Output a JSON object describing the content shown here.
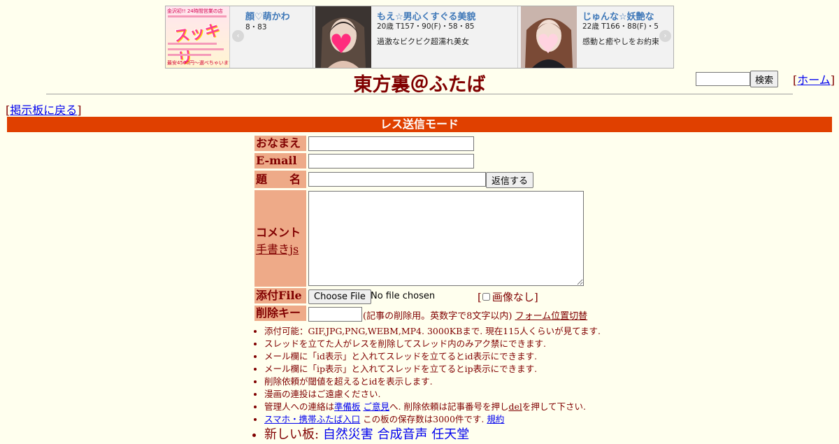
{
  "banner": {
    "ad_left": {
      "line1": "金沢初!! 24時間営業の店",
      "big": "スッキリ",
      "line_bottom": "最安4500円～選べちゃいます!"
    },
    "cards": [
      {
        "title": "顔♡萌かわ",
        "spec": "8・83",
        "desc": ""
      },
      {
        "title": "もえ☆男心くすぐる美貌",
        "spec": "20歳 T157・90(F)・58・85",
        "desc": "過激なビクビク超濡れ美女"
      },
      {
        "title": "じゅんな☆妖艶な",
        "spec": "22歳 T166・88(F)・5",
        "desc": "感動と癒やしをお約束"
      }
    ],
    "prev_glyph": "‹",
    "next_glyph": "›"
  },
  "header": {
    "title": "東方裏＠ふたば",
    "search_button": "検索",
    "home_prefix": "[",
    "home_label": "ホーム",
    "home_suffix": "]",
    "back_prefix": "[",
    "back_label": "掲示板に戻る",
    "back_suffix": "]"
  },
  "mode_bar": "レス送信モード",
  "form": {
    "name_label": "おなまえ",
    "email_label": "E-mail",
    "subject_label": "題　　名",
    "reply_button": "返信する",
    "comment_label": "コメント",
    "handwrite_link": "手書きjs",
    "file_label": "添付File",
    "choose_file_button": "Choose File",
    "no_file_text": "No file chosen",
    "no_image_prefix": "[",
    "no_image_label": "画像なし",
    "no_image_suffix": "]",
    "delete_key_label": "削除キー",
    "delete_key_note": "(記事の削除用。英数字で8文字以内)",
    "form_position_link": "フォーム位置切替"
  },
  "rules": [
    "添付可能：GIF,JPG,PNG,WEBM,MP4. 3000KBまで. 現在115人くらいが見てます.",
    "スレッドを立てた人がレスを削除してスレッド内のみアク禁にできます.",
    "メール欄に「id表示」と入れてスレッドを立てるとid表示にできます.",
    "メール欄に「ip表示」と入れてスレッドを立てるとip表示にできます.",
    "削除依頼が閾値を超えるとidを表示します.",
    "漫画の連投はご遠慮ください."
  ],
  "contact_rule": {
    "prefix": "管理人への連絡は",
    "link1": "準備板",
    "link2": "ご意見",
    "middle": "へ. 削除依頼は記事番号を押し",
    "del_link": "del",
    "suffix": "を押して下さい."
  },
  "mobile_rule": {
    "link": "スマホ・携帯ふたば入口",
    "text": "この板の保存数は3000件です.",
    "terms": "規約"
  },
  "new_boards": {
    "label": "新しい板:",
    "boards": [
      "自然災害",
      "合成音声",
      "任天堂"
    ]
  }
}
